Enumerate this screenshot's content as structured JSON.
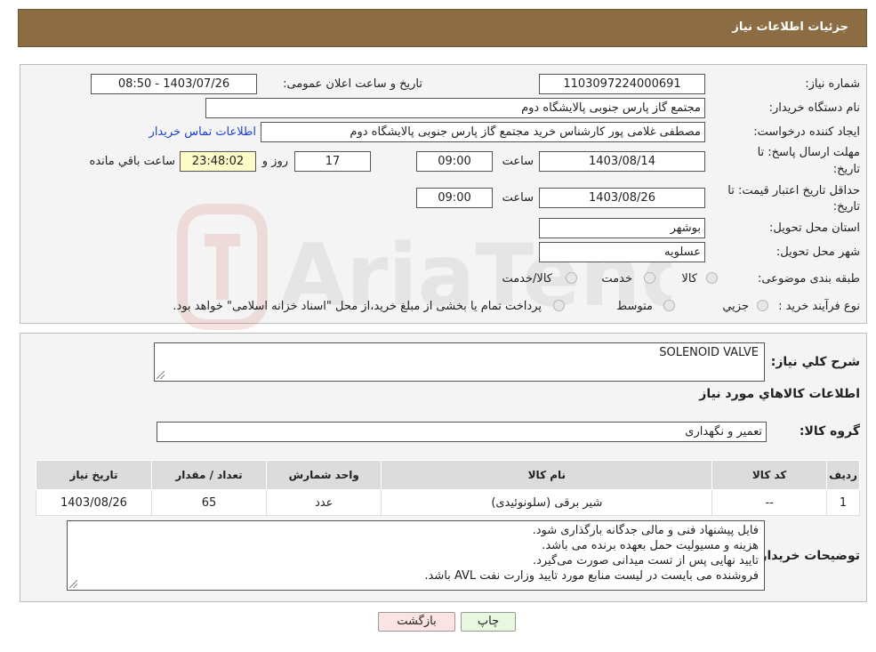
{
  "header": {
    "title": "جزئیات اطلاعات نیاز"
  },
  "form": {
    "need_number_label": "شماره نیاز:",
    "need_number": "1103097224000691",
    "announce_label": "تاریخ و ساعت اعلان عمومی:",
    "announce_value": "1403/07/26 - 08:50",
    "buyer_org_label": "نام دستگاه خریدار:",
    "buyer_org": "مجتمع گاز پارس جنوبی  پالایشگاه دوم",
    "creator_label": "ایجاد کننده درخواست:",
    "creator": "مصطفی غلامی پور کارشناس خرید مجتمع گاز پارس جنوبی  پالایشگاه دوم",
    "contact_link": "اطلاعات تماس خریدار",
    "deadline_label_1": "مهلت ارسال پاسخ: تا",
    "deadline_label_2": "تاریخ:",
    "deadline_date": "1403/08/14",
    "time_label": "ساعت",
    "deadline_time": "09:00",
    "days_value": "17",
    "days_label": "روز و",
    "remaining_time": "23:48:02",
    "remaining_label": "ساعت باقي مانده",
    "validity_label_1": "حداقل تاریخ اعتبار قیمت: تا",
    "validity_label_2": "تاریخ:",
    "validity_date": "1403/08/26",
    "validity_time": "09:00",
    "province_label": "استان محل تحویل:",
    "province": "بوشهر",
    "city_label": "شهر محل تحویل:",
    "city": "عسلویه",
    "category_label": "طبقه بندی موضوعی:",
    "category_options": [
      "کالا",
      "خدمت",
      "کالا/خدمت"
    ],
    "process_label": "نوع فرآیند خرید :",
    "process_options": [
      "جزیي",
      "متوسط"
    ],
    "process_note": "پرداخت تمام یا بخشی از مبلغ خرید،از محل \"اسناد خزانه اسلامی\" خواهد بود."
  },
  "details": {
    "description_label": "شرح کلي نیاز:",
    "description": "SOLENOID VALVE",
    "items_heading": "اطلاعات کالاهاي مورد نیاز",
    "group_label": "گروه کالا:",
    "group_value": "تعمیر و نگهداری",
    "table": {
      "headers": [
        "ردیف",
        "کد کالا",
        "نام کالا",
        "واحد شمارش",
        "تعداد / مقدار",
        "تاریخ نیاز"
      ],
      "rows": [
        [
          "1",
          "--",
          "شیر برقی (سلونوئیدی)",
          "عدد",
          "65",
          "1403/08/26"
        ]
      ]
    },
    "notes_label": "توضیحات خریدار:",
    "notes": [
      "فایل پیشنهاد فنی و مالی جدگانه بارگذاری شود.",
      "هزینه و مسیولیت حمل بعهده برنده می باشد.",
      "تایید نهایی پس از تست میدانی صورت می‌گیرد.",
      "فروشنده می بایست در لیست منابع مورد تایید وزارت نفت AVL باشد."
    ]
  },
  "buttons": {
    "back": "بازگشت",
    "print": "چاپ"
  },
  "watermark": {
    "text": "AriaTender.neT"
  },
  "colors": {
    "header_bg": "#8b6c43",
    "link": "#1a3fd1",
    "highlight": "#fdfbc8",
    "back_button_bg": "#fde4e4",
    "print_button_bg": "#e8f8e0"
  }
}
